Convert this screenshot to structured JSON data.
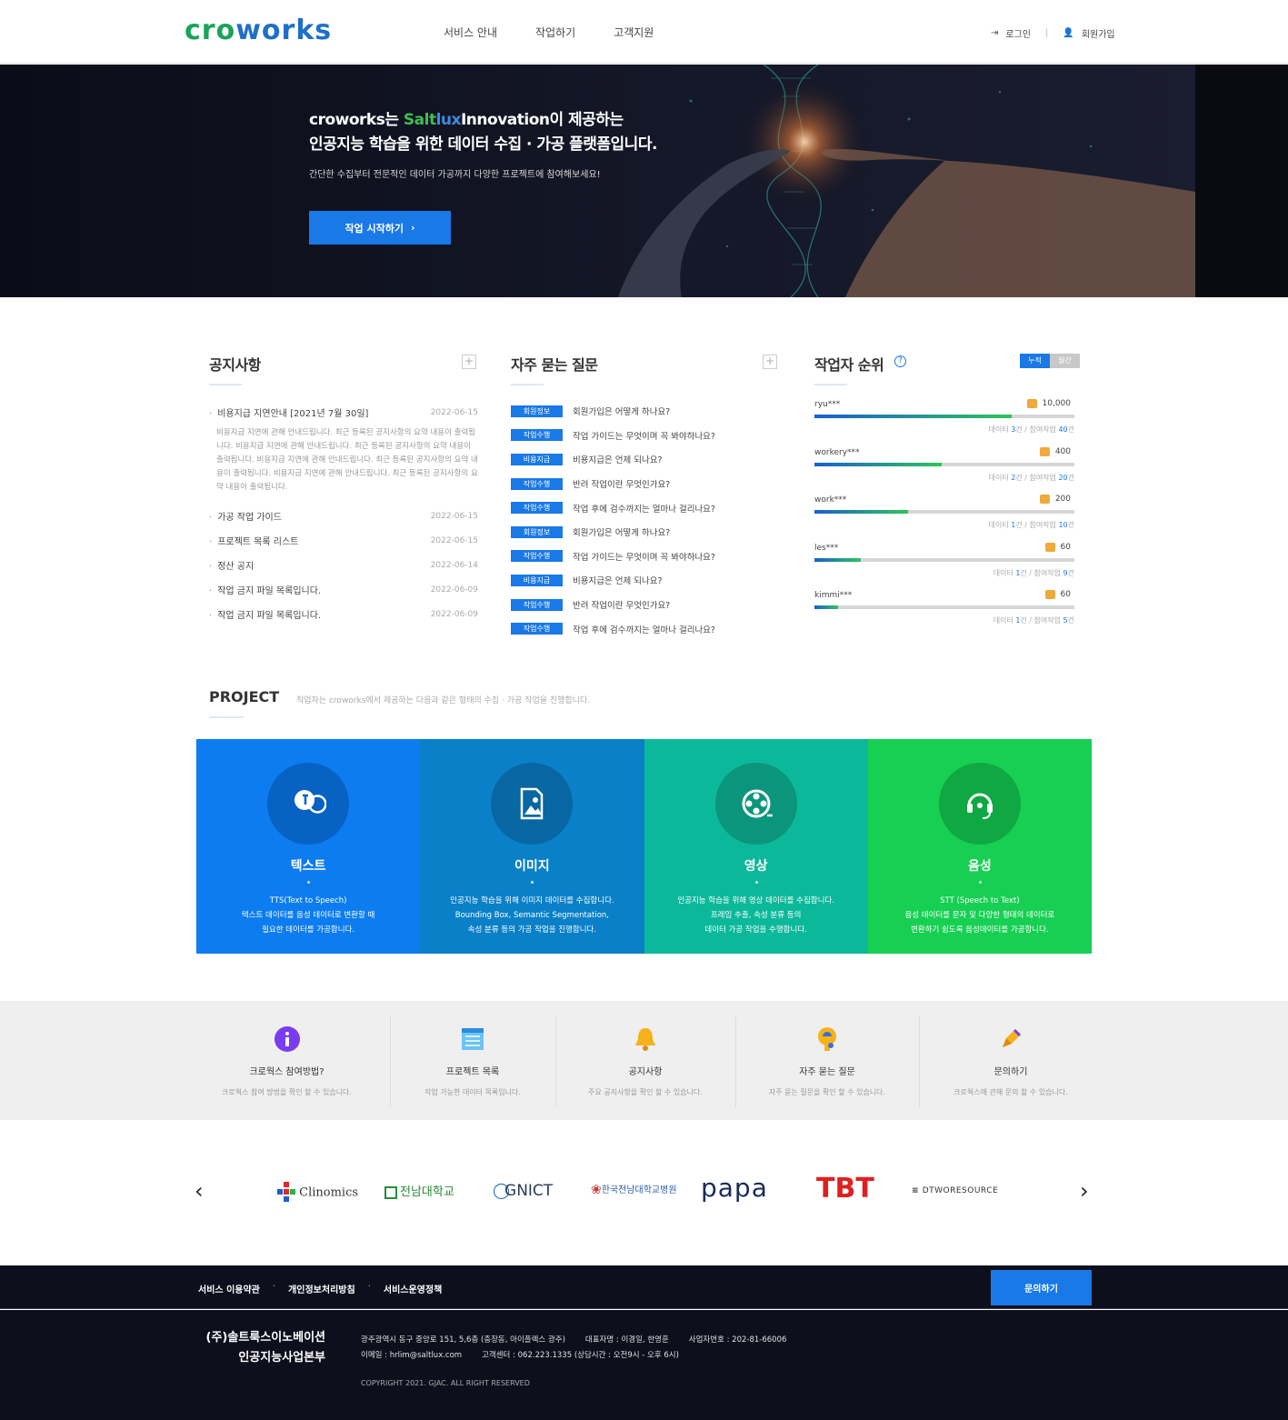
{
  "header": {
    "logo": "croworks",
    "nav": [
      "서비스 안내",
      "작업하기",
      "고객지원"
    ],
    "login": "로그인",
    "signup": "회원가입"
  },
  "hero": {
    "line1_a": "croworks는 ",
    "line1_salt": "Salt",
    "line1_lux": "lux",
    "line1_b": "Innovation이 제공하는",
    "line2": "인공지능 학습을 위한 데이터 수집 · 가공 플랫폼입니다.",
    "subtitle": "간단한 수집부터 전문적인 데이터 가공까지 다양한 프로젝트에 참여해보세요!",
    "cta": "작업 시작하기",
    "cta_arrow": "›"
  },
  "notice": {
    "title": "공지사항",
    "plus": "+",
    "items": [
      {
        "title": "비용지급 지연안내 [2021년 7월 30일]",
        "date": "2022-06-15"
      },
      {
        "title": "가공 작업 가이드",
        "date": "2022-06-15"
      },
      {
        "title": "프로젝트 목록 리스트",
        "date": "2022-06-15"
      },
      {
        "title": "정산 공지",
        "date": "2022-06-14"
      },
      {
        "title": "작업 금지 파일 목록입니다.",
        "date": "2022-06-09"
      },
      {
        "title": "작업 금지 파일 목록입니다.",
        "date": "2022-06-09"
      }
    ],
    "body": "비용지급 지연에 관해 안내드립니다. 최근 등록된 공지사항의 요약 내용이 출력됩니다. 비용지급 지연에 관해 안내드립니다. 최근 등록된 공지사항의 요약 내용이 출력됩니다. 비용지급 지연에 관해 안내드립니다. 최근 등록된 공지사항의 요약 내용이 출력됩니다. 비용지급 지연에 관해 안내드립니다. 최근 등록된 공지사항의 요약 내용이 출력됩니다."
  },
  "faq": {
    "title": "자주 묻는 질문",
    "plus": "+",
    "items": [
      {
        "tag": "회원정보",
        "q": "회원가입은 어떻게 하나요?"
      },
      {
        "tag": "작업수행",
        "q": "작업 가이드는 무엇이며 꼭 봐야하나요?"
      },
      {
        "tag": "비용지급",
        "q": "비용지급은 언제 되나요?"
      },
      {
        "tag": "작업수행",
        "q": "반려 작업이란 무엇인가요?"
      },
      {
        "tag": "작업수행",
        "q": "작업 후에 검수까지는 얼마나 걸리나요?"
      },
      {
        "tag": "회원정보",
        "q": "회원가입은 어떻게 하나요?"
      },
      {
        "tag": "작업수행",
        "q": "작업 가이드는 무엇이며 꼭 봐야하나요?"
      },
      {
        "tag": "비용지급",
        "q": "비용지급은 언제 되나요?"
      },
      {
        "tag": "작업수행",
        "q": "반려 작업이란 무엇인가요?"
      },
      {
        "tag": "작업수행",
        "q": "작업 후에 검수까지는 얼마나 걸리나요?"
      }
    ]
  },
  "ranking": {
    "title": "작업자 순위",
    "help": "?",
    "toggle_on": "누적",
    "toggle_off": "월간",
    "items": [
      {
        "name": "ryu***",
        "points": "10,000",
        "progress": 0.76,
        "meta_a": "데이터 ",
        "data": "3",
        "meta_b": "건 / 참여작업 ",
        "jobs": "40",
        "meta_c": "건"
      },
      {
        "name": "workery***",
        "points": "400",
        "progress": 0.49,
        "meta_a": "데이터 ",
        "data": "2",
        "meta_b": "건 / 참여작업 ",
        "jobs": "20",
        "meta_c": "건"
      },
      {
        "name": "work***",
        "points": "200",
        "progress": 0.36,
        "meta_a": "데이터 ",
        "data": "1",
        "meta_b": "건 / 참여작업 ",
        "jobs": "10",
        "meta_c": "건"
      },
      {
        "name": "les***",
        "points": "60",
        "progress": 0.18,
        "meta_a": "데이터 ",
        "data": "1",
        "meta_b": "건 / 참여작업 ",
        "jobs": "9",
        "meta_c": "건"
      },
      {
        "name": "kimmi***",
        "points": "60",
        "progress": 0.09,
        "meta_a": "데이터 ",
        "data": "1",
        "meta_b": "건 / 참여작업 ",
        "jobs": "5",
        "meta_c": "건"
      }
    ]
  },
  "project": {
    "title": "PROJECT",
    "desc": "작업자는 croworks에서 제공하는 다음과 같은 형태의 수집 · 가공 작업을 진행합니다.",
    "cards": [
      {
        "name": "텍스트",
        "line1": "TTS(Text to Speech)",
        "line2": "텍스트 데이터를 음성 데이터로 변환할 때",
        "line3": "필요한 데이터를 가공합니다.",
        "bg": "#0c7cf0",
        "circle": "#0862c4"
      },
      {
        "name": "이미지",
        "line1": "인공지능 학습을 위해 이미지 데이터를 수집합니다.",
        "line2": "Bounding Box, Semantic Segmentation,",
        "line3": "속성 분류 등의 가공 작업을 진행합니다.",
        "bg": "#0a80c8",
        "circle": "#0866a3"
      },
      {
        "name": "영상",
        "line1": "인공지능 학습을 위해 영상 데이터를 수집합니다.",
        "line2": "프레임 추출, 속성 분류 등의",
        "line3": "데이터 가공 작업을 수행합니다.",
        "bg": "#0cb89a",
        "circle": "#0a957c"
      },
      {
        "name": "음성",
        "line1": "STT (Speech to Text)",
        "line2": "음성 데이터를 문자 및 다양한 형태의 데이터로",
        "line3": "변환하기 쉽도록 음성데이터를 가공합니다.",
        "bg": "#17cf52",
        "circle": "#10a842"
      }
    ]
  },
  "quick": [
    {
      "title": "크로웍스 참여방법?",
      "desc": "크로웍스 참여 방법을 확인 할 수 있습니다.",
      "icon": "info-icon"
    },
    {
      "title": "프로젝트 목록",
      "desc": "작업 가능한 데이터 목록입니다.",
      "icon": "list-icon"
    },
    {
      "title": "공지사항",
      "desc": "주요 공지사항을 확인 할 수 있습니다.",
      "icon": "bell-icon"
    },
    {
      "title": "자주 묻는 질문",
      "desc": "자주 묻는 질문을 확인 할 수 있습니다.",
      "icon": "question-icon"
    },
    {
      "title": "문의하기",
      "desc": "크로웍스에 관해 문의 할 수 있습니다.",
      "icon": "pen-icon"
    }
  ],
  "partners": {
    "prev": "‹",
    "next": "›",
    "logos": [
      "Clinomics",
      "전남대학교",
      "GNICT",
      "한국전남대학교병원",
      "papa",
      "TBT",
      "DTWORESOURCE"
    ]
  },
  "footer": {
    "links": [
      "서비스 이용약관",
      "개인정보처리방침",
      "서비스운영정책"
    ],
    "dot": "·",
    "contact": "문의하기",
    "company1": "(주)솔트룩스이노베이션",
    "company2": "인공지능사업본부",
    "addr": "광주광역시 동구 중앙로 151, 5,6층 (충장동, 아이플렉스 광주)",
    "ceo": "대표자명 : 이경일, 한영훈",
    "biz": "사업자번호 : 202-81-66006",
    "email": "이메일 : hrlim@saltlux.com",
    "tel": "고객센터 : 062.223.1335 (상담시간 : 오전9시 - 오후 6시)",
    "copyright": "COPYRIGHT 2021. GJAC. ALL RIGHT RESERVED"
  }
}
